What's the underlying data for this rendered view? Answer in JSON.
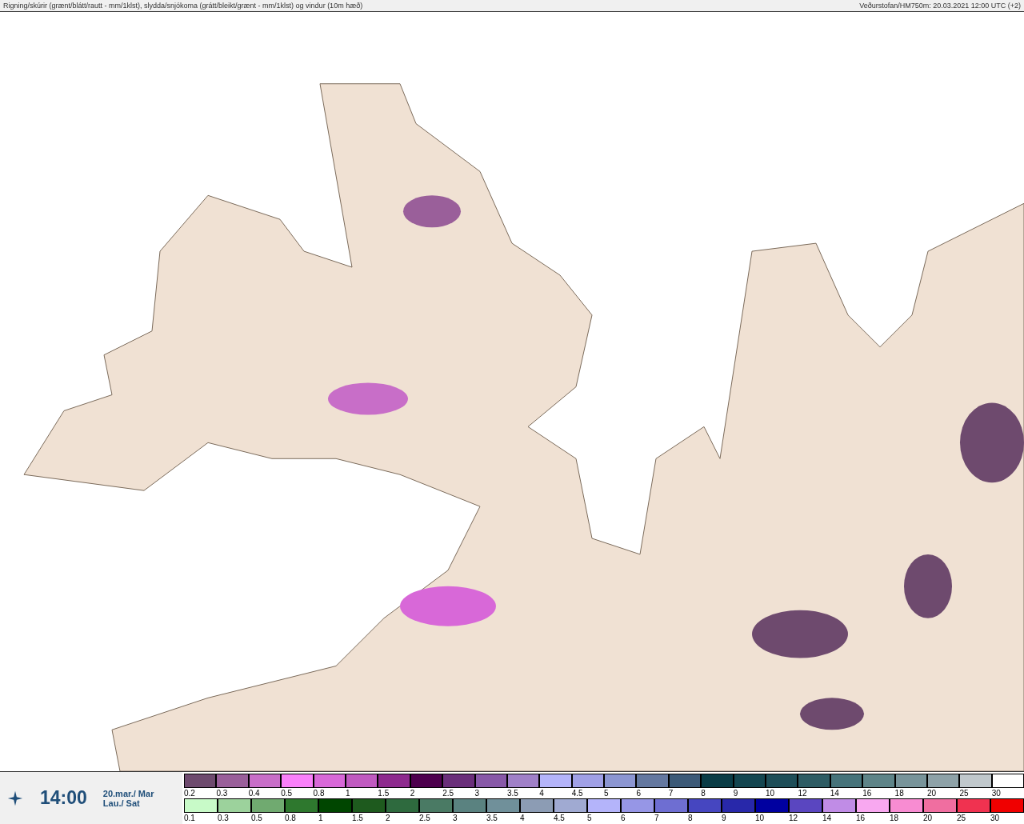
{
  "header": {
    "title": "Rigning/skúrir (grænt/blátt/rautt - mm/1klst), slydda/snjókoma (grátt/bleikt/grænt - mm/1klst) og vindur (10m hæð)",
    "source": "Veðurstofan/HM750m: 20.03.2021 12:00 UTC (+2)"
  },
  "footer": {
    "time": "14:00",
    "date_line_1": "20.mar./ Mar",
    "date_line_2": "Lau./ Sat"
  },
  "legend_rows": [
    {
      "items": [
        {
          "label": "0.2",
          "color": "#6e4a6e"
        },
        {
          "label": "0.3",
          "color": "#9a5f9a"
        },
        {
          "label": "0.4",
          "color": "#c86ec8"
        },
        {
          "label": "0.5",
          "color": "#fa80fa"
        },
        {
          "label": "0.8",
          "color": "#d868d8"
        },
        {
          "label": "1",
          "color": "#c05ac0"
        },
        {
          "label": "1.5",
          "color": "#8e2a8e"
        },
        {
          "label": "2",
          "color": "#4e004e"
        },
        {
          "label": "2.5",
          "color": "#6a2e7a"
        },
        {
          "label": "3",
          "color": "#8858a8"
        },
        {
          "label": "3.5",
          "color": "#a080c8"
        },
        {
          "label": "4",
          "color": "#b4b4fa"
        },
        {
          "label": "4.5",
          "color": "#a0a0e6"
        },
        {
          "label": "5",
          "color": "#8c96d2"
        },
        {
          "label": "6",
          "color": "#6478a0"
        },
        {
          "label": "7",
          "color": "#3c5a78"
        },
        {
          "label": "8",
          "color": "#0a3c46"
        },
        {
          "label": "9",
          "color": "#144650"
        },
        {
          "label": "10",
          "color": "#1e4e58"
        },
        {
          "label": "12",
          "color": "#2e5c64"
        },
        {
          "label": "14",
          "color": "#46737a"
        },
        {
          "label": "16",
          "color": "#5e8488"
        },
        {
          "label": "18",
          "color": "#78949a"
        },
        {
          "label": "20",
          "color": "#8ea2a8"
        },
        {
          "label": "25",
          "color": "#c0c8cc"
        },
        {
          "label": "30",
          "color": "#ffffff"
        }
      ]
    },
    {
      "items": [
        {
          "label": "0.1",
          "color": "#c8fac8"
        },
        {
          "label": "0.3",
          "color": "#9cd29c"
        },
        {
          "label": "0.5",
          "color": "#70aa70"
        },
        {
          "label": "0.8",
          "color": "#2e782e"
        },
        {
          "label": "1",
          "color": "#004600"
        },
        {
          "label": "1.5",
          "color": "#1e5a1e"
        },
        {
          "label": "2",
          "color": "#2e6a3e"
        },
        {
          "label": "2.5",
          "color": "#4a7a64"
        },
        {
          "label": "3",
          "color": "#5a8280"
        },
        {
          "label": "3.5",
          "color": "#70909a"
        },
        {
          "label": "4",
          "color": "#8c9cb4"
        },
        {
          "label": "4.5",
          "color": "#a0aad2"
        },
        {
          "label": "5",
          "color": "#b4b4fa"
        },
        {
          "label": "6",
          "color": "#9696e6"
        },
        {
          "label": "7",
          "color": "#6e6ed2"
        },
        {
          "label": "8",
          "color": "#4646c0"
        },
        {
          "label": "9",
          "color": "#2828aa"
        },
        {
          "label": "10",
          "color": "#0000a0"
        },
        {
          "label": "12",
          "color": "#5a46c0"
        },
        {
          "label": "14",
          "color": "#c08ce6"
        },
        {
          "label": "16",
          "color": "#f8a8f0"
        },
        {
          "label": "18",
          "color": "#f88cd2"
        },
        {
          "label": "20",
          "color": "#f06ea0"
        },
        {
          "label": "25",
          "color": "#f03250"
        },
        {
          "label": "30",
          "color": "#f00000"
        }
      ]
    }
  ]
}
